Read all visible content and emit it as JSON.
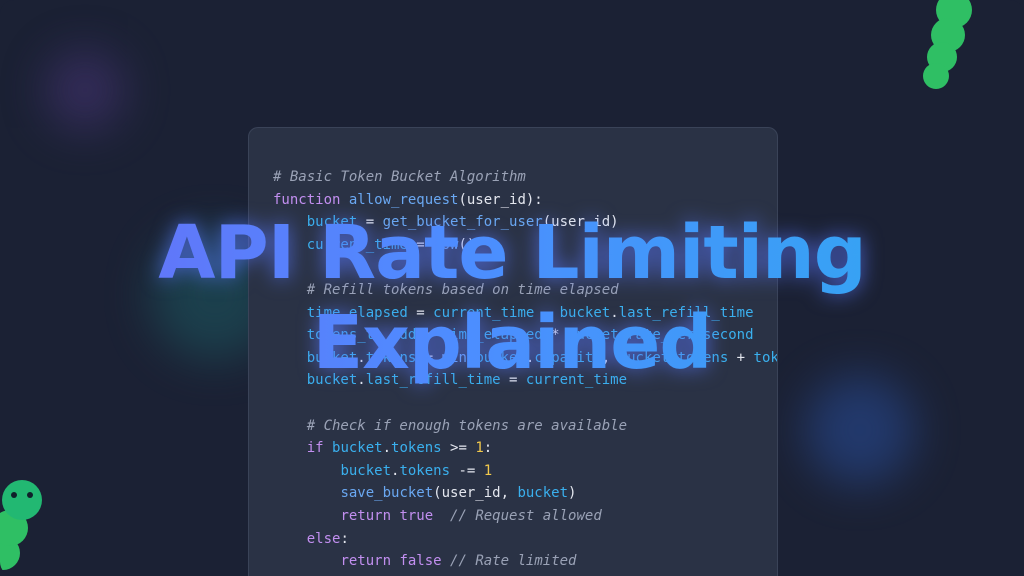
{
  "title": {
    "line1": "API Rate Limiting",
    "line2": "Explained"
  },
  "colors": {
    "background": "#1b2134",
    "card": "#2a3245",
    "title_gradient_start": "#6a6cf6",
    "title_gradient_end": "#2eaaf0",
    "worm": "#2fbf64"
  },
  "code": {
    "lines": [
      [
        {
          "t": "# Basic Token Bucket Algorithm",
          "c": "cm"
        }
      ],
      [
        {
          "t": "function",
          "c": "kw"
        },
        {
          "t": " ",
          "c": "pl"
        },
        {
          "t": "allow_request",
          "c": "fn"
        },
        {
          "t": "(user_id):",
          "c": "pl"
        }
      ],
      [
        {
          "t": "    ",
          "c": "pl"
        },
        {
          "t": "bucket",
          "c": "id"
        },
        {
          "t": " = ",
          "c": "pl"
        },
        {
          "t": "get_bucket_for_user",
          "c": "fn"
        },
        {
          "t": "(user_id)",
          "c": "pl"
        }
      ],
      [
        {
          "t": "    ",
          "c": "pl"
        },
        {
          "t": "current_time",
          "c": "id"
        },
        {
          "t": " = ",
          "c": "pl"
        },
        {
          "t": "now",
          "c": "fn"
        },
        {
          "t": "()",
          "c": "pl"
        }
      ],
      [
        {
          "t": "",
          "c": "pl"
        }
      ],
      [
        {
          "t": "    ",
          "c": "pl"
        },
        {
          "t": "# Refill tokens based on time elapsed",
          "c": "cm"
        }
      ],
      [
        {
          "t": "    ",
          "c": "pl"
        },
        {
          "t": "time_elapsed",
          "c": "id"
        },
        {
          "t": " = ",
          "c": "pl"
        },
        {
          "t": "current_time",
          "c": "id"
        },
        {
          "t": " - ",
          "c": "pl"
        },
        {
          "t": "bucket",
          "c": "id"
        },
        {
          "t": ".",
          "c": "pl"
        },
        {
          "t": "last_refill_time",
          "c": "id"
        }
      ],
      [
        {
          "t": "    ",
          "c": "pl"
        },
        {
          "t": "tokens_to_add",
          "c": "id"
        },
        {
          "t": " = ",
          "c": "pl"
        },
        {
          "t": "time_elapsed",
          "c": "id"
        },
        {
          "t": " * ",
          "c": "pl"
        },
        {
          "t": "bucket",
          "c": "id"
        },
        {
          "t": ".",
          "c": "pl"
        },
        {
          "t": "rate_per_second",
          "c": "id"
        }
      ],
      [
        {
          "t": "    ",
          "c": "pl"
        },
        {
          "t": "bucket",
          "c": "id"
        },
        {
          "t": ".",
          "c": "pl"
        },
        {
          "t": "tokens",
          "c": "id"
        },
        {
          "t": " = ",
          "c": "pl"
        },
        {
          "t": "min",
          "c": "fn"
        },
        {
          "t": "(",
          "c": "pl"
        },
        {
          "t": "bucket",
          "c": "id"
        },
        {
          "t": ".",
          "c": "pl"
        },
        {
          "t": "capacity",
          "c": "id"
        },
        {
          "t": ", ",
          "c": "pl"
        },
        {
          "t": "bucket",
          "c": "id"
        },
        {
          "t": ".",
          "c": "pl"
        },
        {
          "t": "tokens",
          "c": "id"
        },
        {
          "t": " + ",
          "c": "pl"
        },
        {
          "t": "tokens_to_add",
          "c": "id"
        },
        {
          "t": ")",
          "c": "pl"
        }
      ],
      [
        {
          "t": "    ",
          "c": "pl"
        },
        {
          "t": "bucket",
          "c": "id"
        },
        {
          "t": ".",
          "c": "pl"
        },
        {
          "t": "last_refill_time",
          "c": "id"
        },
        {
          "t": " = ",
          "c": "pl"
        },
        {
          "t": "current_time",
          "c": "id"
        }
      ],
      [
        {
          "t": "",
          "c": "pl"
        }
      ],
      [
        {
          "t": "    ",
          "c": "pl"
        },
        {
          "t": "# Check if enough tokens are available",
          "c": "cm"
        }
      ],
      [
        {
          "t": "    ",
          "c": "pl"
        },
        {
          "t": "if",
          "c": "kw"
        },
        {
          "t": " ",
          "c": "pl"
        },
        {
          "t": "bucket",
          "c": "id"
        },
        {
          "t": ".",
          "c": "pl"
        },
        {
          "t": "tokens",
          "c": "id"
        },
        {
          "t": " >= ",
          "c": "pl"
        },
        {
          "t": "1",
          "c": "num"
        },
        {
          "t": ":",
          "c": "pl"
        }
      ],
      [
        {
          "t": "        ",
          "c": "pl"
        },
        {
          "t": "bucket",
          "c": "id"
        },
        {
          "t": ".",
          "c": "pl"
        },
        {
          "t": "tokens",
          "c": "id"
        },
        {
          "t": " -= ",
          "c": "pl"
        },
        {
          "t": "1",
          "c": "num"
        }
      ],
      [
        {
          "t": "        ",
          "c": "pl"
        },
        {
          "t": "save_bucket",
          "c": "fn"
        },
        {
          "t": "(user_id, ",
          "c": "pl"
        },
        {
          "t": "bucket",
          "c": "id"
        },
        {
          "t": ")",
          "c": "pl"
        }
      ],
      [
        {
          "t": "        ",
          "c": "pl"
        },
        {
          "t": "return",
          "c": "kw"
        },
        {
          "t": " ",
          "c": "pl"
        },
        {
          "t": "true",
          "c": "kw"
        },
        {
          "t": "  ",
          "c": "pl"
        },
        {
          "t": "// Request allowed",
          "c": "cm"
        }
      ],
      [
        {
          "t": "    ",
          "c": "pl"
        },
        {
          "t": "else",
          "c": "kw"
        },
        {
          "t": ":",
          "c": "pl"
        }
      ],
      [
        {
          "t": "        ",
          "c": "pl"
        },
        {
          "t": "return",
          "c": "kw"
        },
        {
          "t": " ",
          "c": "pl"
        },
        {
          "t": "false",
          "c": "kw"
        },
        {
          "t": " ",
          "c": "pl"
        },
        {
          "t": "// Rate limited",
          "c": "cm"
        }
      ]
    ]
  }
}
